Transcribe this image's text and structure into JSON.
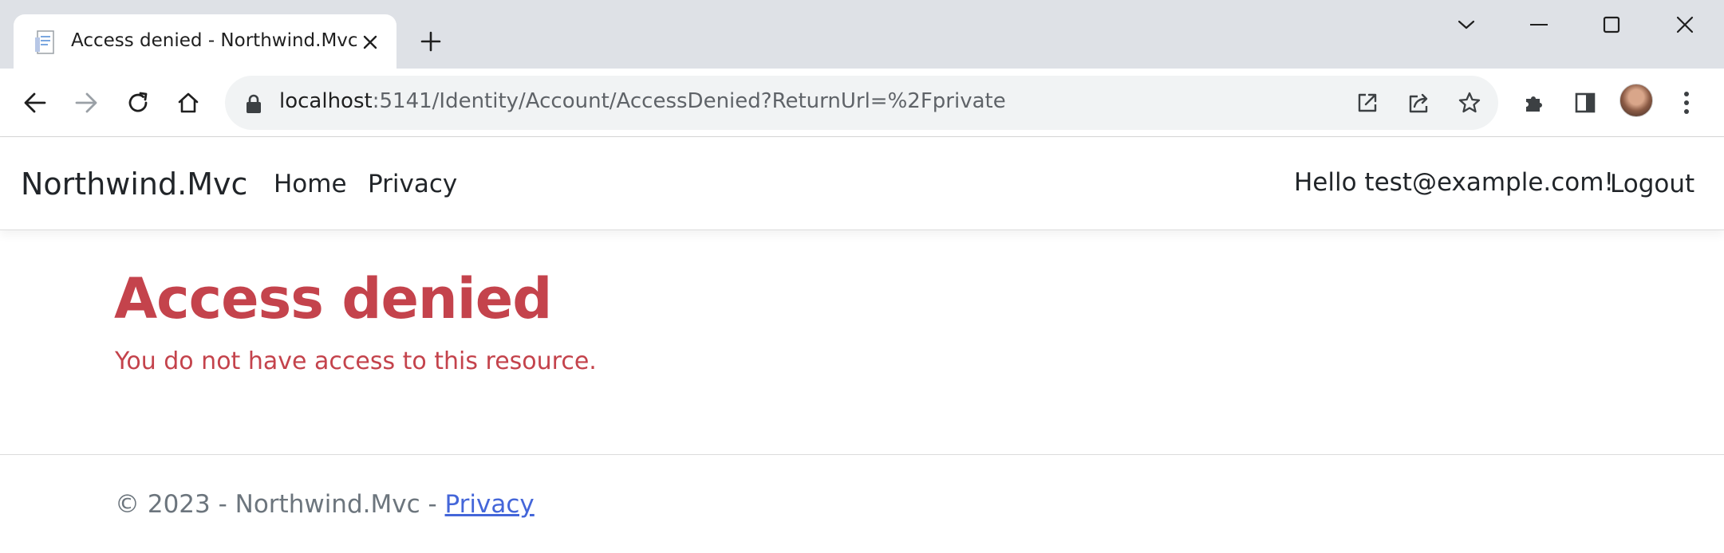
{
  "browser": {
    "tab_title": "Access denied - Northwind.Mvc",
    "url_host": "localhost",
    "url_rest": ":5141/Identity/Account/AccessDenied?ReturnUrl=%2Fprivate",
    "icons": {
      "back": "back-arrow-icon",
      "forward": "forward-arrow-icon",
      "reload": "reload-icon",
      "home": "home-icon",
      "lock": "lock-icon",
      "open_in_app": "open-in-window-icon",
      "share": "share-icon",
      "bookmark": "star-icon",
      "extensions": "puzzle-icon",
      "side_panel": "side-panel-icon",
      "menu": "kebab-menu-icon"
    }
  },
  "navbar": {
    "brand": "Northwind.Mvc",
    "links": [
      "Home",
      "Privacy"
    ],
    "greeting": "Hello test@example.com!",
    "logout": "Logout"
  },
  "main": {
    "heading": "Access denied",
    "message": "You do not have access to this resource."
  },
  "footer": {
    "copyright": "© 2023 - Northwind.Mvc - ",
    "privacy_link": "Privacy"
  },
  "colors": {
    "danger": "#c4434c",
    "link": "#4466d9",
    "muted": "#6c757d",
    "tabstrip": "#dee1e6",
    "omnibox": "#f1f3f4"
  }
}
